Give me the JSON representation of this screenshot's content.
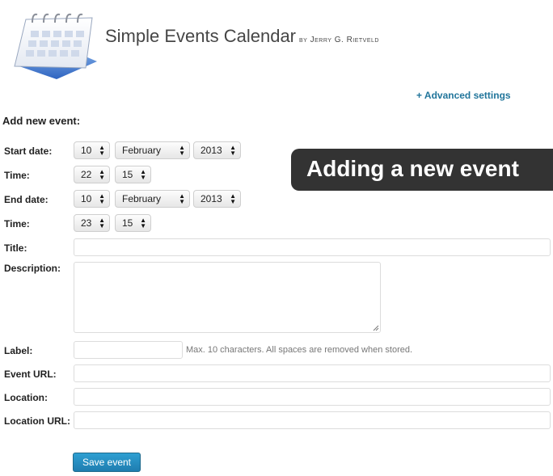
{
  "header": {
    "title": "Simple Events Calendar",
    "byline": "by Jerry G. Rietveld"
  },
  "advanced_settings_link": "+ Advanced settings",
  "section_title": "Add new event:",
  "form": {
    "start_date": {
      "label": "Start date:",
      "day": "10",
      "month": "February",
      "year": "2013"
    },
    "start_time": {
      "label": "Time:",
      "hour": "22",
      "minute": "15"
    },
    "end_date": {
      "label": "End date:",
      "day": "10",
      "month": "February",
      "year": "2013"
    },
    "end_time": {
      "label": "Time:",
      "hour": "23",
      "minute": "15"
    },
    "title": {
      "label": "Title:",
      "value": ""
    },
    "description": {
      "label": "Description:",
      "value": ""
    },
    "event_label": {
      "label": "Label:",
      "value": "",
      "hint": "Max. 10 characters. All spaces are removed when stored."
    },
    "event_url": {
      "label": "Event URL:",
      "value": ""
    },
    "location": {
      "label": "Location:",
      "value": ""
    },
    "location_url": {
      "label": "Location URL:",
      "value": ""
    }
  },
  "save_button": "Save event",
  "overlay_banner": "Adding a new event",
  "icons": {
    "calendar": "calendar-icon",
    "select_arrows": "up-down-arrows-icon"
  },
  "colors": {
    "link": "#21759b",
    "button": "#2089bd",
    "banner_bg": "#333333"
  }
}
